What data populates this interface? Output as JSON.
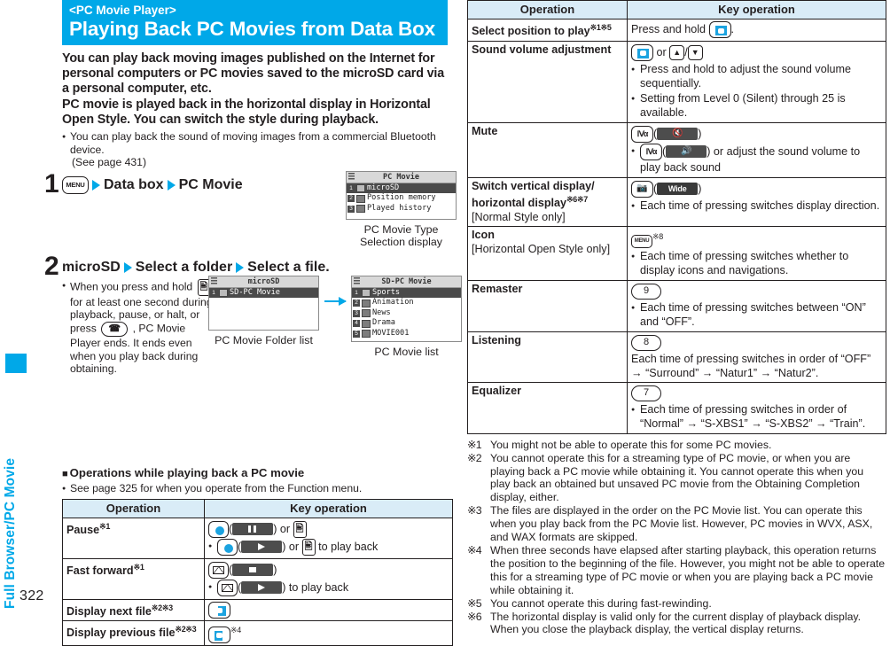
{
  "page": {
    "number": "322",
    "side_tab_label": "Full Browser/PC Movie"
  },
  "banner": {
    "kicker": "<PC Movie Player>",
    "title": "Playing Back PC Movies from Data Box",
    "color": "#00a8e8"
  },
  "lead": {
    "paragraph1": "You can play back moving images published on the Internet for personal computers or PC movies saved to the microSD card via a personal computer, etc.",
    "paragraph2": "PC movie is played back in the horizontal display in Horizontal Open Style. You can switch the style during playback.",
    "bullet": "You can play back the sound of moving images from a commercial Bluetooth device.",
    "bullet_cont": "(See page 431)"
  },
  "steps": [
    {
      "number": "1",
      "parts": [
        "Data box",
        "PC Movie"
      ],
      "key_icon": "menu-key-icon",
      "screen": {
        "title": "PC Movie",
        "items": [
          "microSD",
          "Position memory",
          "Played history"
        ],
        "selected_index": 0
      },
      "caption": "PC Movie Type\nSelection display",
      "caption_line1": "PC Movie Type",
      "caption_line2": "Selection display"
    },
    {
      "number": "2",
      "parts": [
        "microSD",
        "Select a folder",
        "Select a file."
      ],
      "note": "When you press and hold ▯ for at least one second during playback, pause, or halt, or press ☎, PC Movie Player ends. It ends even when you play back during obtaining.",
      "note_lines": [
        "When you press and hold",
        "for at least one second",
        "during playback, pause, or",
        "halt, or press",
        ", PC",
        "Movie Player ends. It ends",
        "even when you play back",
        "during obtaining."
      ],
      "screen_left": {
        "title": "microSD",
        "items": [
          "SD-PC Movie"
        ],
        "selected_index": 0,
        "caption": "PC Movie Folder list"
      },
      "screen_right": {
        "title": "SD-PC Movie",
        "items": [
          "Sports",
          "Animation",
          "News",
          "Drama",
          "MOVIE001"
        ],
        "selected_index": 0,
        "caption": "PC Movie list"
      }
    }
  ],
  "section": {
    "heading": "Operations while playing back a PC movie",
    "note": "See page 325 for when you operate from the Function menu."
  },
  "table_left": {
    "headers": [
      "Operation",
      "Key operation"
    ],
    "rows": [
      {
        "operation": "Pause",
        "sup": "※1",
        "key_lines": [
          {
            "type": "main",
            "text_after_key": "or"
          },
          {
            "type": "bullet",
            "text_after_key": "or",
            "tail": "to play back"
          }
        ]
      },
      {
        "operation": "Fast forward",
        "sup": "※1",
        "key_lines": [
          {
            "type": "main",
            "text_after_key": ""
          },
          {
            "type": "bullet",
            "text_after_key": "",
            "tail": "to play back"
          }
        ]
      },
      {
        "operation": "Display next file",
        "sup": "※2※3",
        "key_lines": []
      },
      {
        "operation": "Display previous file",
        "sup": "※2※3",
        "key_lines": [],
        "trailing_sup": "※4"
      }
    ]
  },
  "table_right": {
    "headers": [
      "Operation",
      "Key operation"
    ],
    "rows": [
      {
        "operation": "Select position to play",
        "sup": "※1※5",
        "key_text_before": "Press and hold",
        "key_text_after": "."
      },
      {
        "operation": "Sound volume adjustment",
        "key_mid": "or",
        "bullets": [
          "Press and hold to adjust the sound volume sequentially.",
          "Setting from Level 0 (Silent) through 25 is available."
        ]
      },
      {
        "operation": "Mute",
        "bullets": [
          "or adjust the sound volume to play back sound"
        ]
      },
      {
        "operation": "Switch vertical display/ horizontal display",
        "sup": "※6※7",
        "operation_sub": "[Normal Style only]",
        "soft_label": "Wide",
        "bullets": [
          "Each time of pressing switches display direction."
        ]
      },
      {
        "operation": "Icon",
        "operation_sub": "[Horizontal Open Style only]",
        "key_sup": "※8",
        "bullets": [
          "Each time of pressing switches whether to display icons and navigations."
        ]
      },
      {
        "operation": "Remaster",
        "key_label": "9",
        "bullets": [
          "Each time of pressing switches between “ON” and “OFF”."
        ]
      },
      {
        "operation": "Listening",
        "key_label": "8",
        "plain": "Each time of pressing switches in order of “OFF” → “Surround” → “Natur1” → “Natur2”."
      },
      {
        "operation": "Equalizer",
        "key_label": "7",
        "bullets": [
          "Each time of pressing switches in order of “Normal” → “S-XBS1” → “S-XBS2” → “Train”."
        ]
      }
    ]
  },
  "footnotes": [
    {
      "mark": "※1",
      "text": "You might not be able to operate this for some PC movies."
    },
    {
      "mark": "※2",
      "text": "You cannot operate this for a streaming type of PC movie, or when you are playing back a PC movie while obtaining it. You cannot operate this when you play back an obtained but unsaved PC movie from the Obtaining Completion display, either."
    },
    {
      "mark": "※3",
      "text": "The files are displayed in the order on the PC Movie list. You can operate this when you play back from the PC Movie list. However, PC movies in WVX, ASX, and WAX formats are skipped."
    },
    {
      "mark": "※4",
      "text": "When three seconds have elapsed after starting playback, this operation returns the position to the beginning of the file. However, you might not be able to operate this for a streaming type of PC movie or when you are playing back a PC movie while obtaining it."
    },
    {
      "mark": "※5",
      "text": "You cannot operate this during fast-rewinding."
    },
    {
      "mark": "※6",
      "text": "The horizontal display is valid only for the current display of playback display. When you close the playback display, the vertical display returns."
    }
  ]
}
